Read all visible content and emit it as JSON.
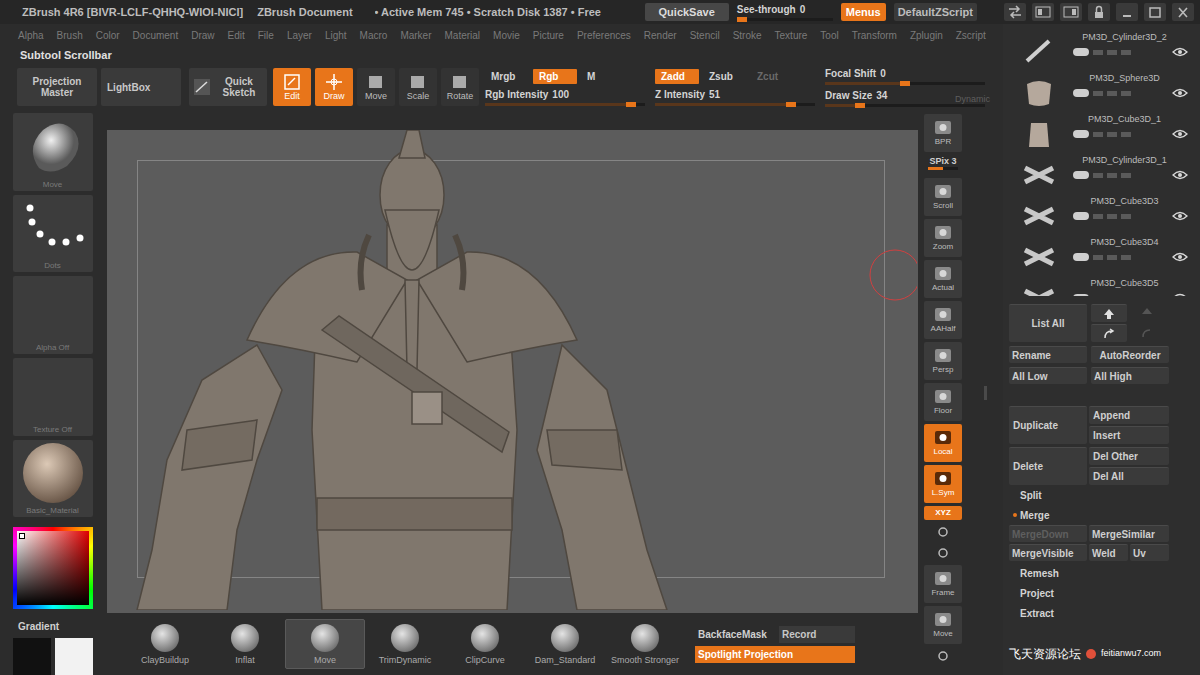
{
  "title_bar": {
    "app": "ZBrush 4R6 [BIVR-LCLF-QHHQ-WIOI-NICI]",
    "document": "ZBrush Document",
    "status": "• Active Mem 745 • Scratch Disk 1387 • Free",
    "quicksave": "QuickSave",
    "see_through": {
      "label": "See-through",
      "value": "0",
      "level": 0
    },
    "menus": {
      "label": "Menus",
      "on": true
    },
    "script": "DefaultZScript"
  },
  "menu_bar": [
    "Alpha",
    "Brush",
    "Color",
    "Document",
    "Draw",
    "Edit",
    "File",
    "Layer",
    "Light",
    "Macro",
    "Marker",
    "Material",
    "Movie",
    "Picture",
    "Preferences",
    "Render",
    "Stencil",
    "Stroke",
    "Texture",
    "Tool",
    "Transform",
    "Zplugin",
    "Zscript"
  ],
  "scrollbar_label": "Subtool Scrollbar",
  "toolbar": {
    "big_buttons": [
      "Projection Master",
      "LightBox",
      "Quick Sketch"
    ],
    "modes": [
      {
        "label": "Edit",
        "on": true
      },
      {
        "label": "Draw",
        "on": true
      },
      {
        "label": "Move",
        "on": false
      },
      {
        "label": "Scale",
        "on": false
      },
      {
        "label": "Rotate",
        "on": false
      }
    ],
    "color_modes": [
      {
        "label": "Mrgb",
        "on": false
      },
      {
        "label": "Rgb",
        "on": true
      },
      {
        "label": "M",
        "on": false
      }
    ],
    "rgb_intensity": {
      "label": "Rgb Intensity",
      "value": "100",
      "level": 0.94
    },
    "z_modes": [
      {
        "label": "Zadd",
        "on": true,
        "disabled": false
      },
      {
        "label": "Zsub",
        "on": false,
        "disabled": false
      },
      {
        "label": "Zcut",
        "on": false,
        "disabled": true
      }
    ],
    "z_intensity": {
      "label": "Z Intensity",
      "value": "51",
      "level": 0.87
    },
    "focal_shift": {
      "label": "Focal Shift",
      "value": "0",
      "level": 0.5
    },
    "draw_size": {
      "label": "Draw Size",
      "value": "34",
      "level": 0.2
    },
    "dynamic": {
      "label": "Dynamic",
      "disabled": true
    }
  },
  "left_tools": [
    {
      "label": "Move",
      "kind": "brush"
    },
    {
      "label": "Dots",
      "kind": "stroke"
    },
    {
      "label": "Alpha Off",
      "kind": "empty"
    },
    {
      "label": "Texture Off",
      "kind": "empty"
    },
    {
      "label": "Basic_Material",
      "kind": "material"
    }
  ],
  "gradient_label": "Gradient",
  "shelf": {
    "brushes": [
      {
        "label": "ClayBuildup",
        "selected": false
      },
      {
        "label": "Inflat",
        "selected": false
      },
      {
        "label": "Move",
        "selected": true
      },
      {
        "label": "TrimDynamic",
        "selected": false
      },
      {
        "label": "ClipCurve",
        "selected": false
      },
      {
        "label": "Dam_Standard",
        "selected": false
      },
      {
        "label": "Smooth Stronger",
        "selected": false
      }
    ],
    "backface_mask": {
      "label": "BackfaceMask",
      "on": false
    },
    "record": "Record",
    "spotlight": {
      "label": "Spotlight Projection",
      "on": true
    }
  },
  "view_strip": [
    {
      "label": "BPR",
      "kind": "icon",
      "on": false
    },
    {
      "label": "SPix 3",
      "kind": "slider",
      "level": 0.5
    },
    {
      "label": "Scroll",
      "kind": "icon",
      "on": false
    },
    {
      "label": "Zoom",
      "kind": "icon",
      "on": false
    },
    {
      "label": "Actual",
      "kind": "icon",
      "on": false
    },
    {
      "label": "AAHalf",
      "kind": "icon",
      "on": false
    },
    {
      "label": "Persp",
      "kind": "icon",
      "on": false
    },
    {
      "label": "Floor",
      "kind": "icon",
      "on": false
    },
    {
      "label": "Local",
      "kind": "icon",
      "on": true
    },
    {
      "label": "L.Sym",
      "kind": "icon",
      "on": true
    },
    {
      "label": "XYZ",
      "kind": "small",
      "on": true
    },
    {
      "kind": "mini",
      "on": false
    },
    {
      "kind": "mini",
      "on": false
    },
    {
      "label": "Frame",
      "kind": "icon",
      "on": false
    },
    {
      "label": "Move",
      "kind": "icon",
      "on": false
    },
    {
      "kind": "mini",
      "on": false
    }
  ],
  "subtools": {
    "items": [
      {
        "name": "PM3D_Cylinder3D_2",
        "visible": true,
        "selected": false
      },
      {
        "name": "PM3D_Sphere3D",
        "visible": true,
        "selected": false
      },
      {
        "name": "PM3D_Cube3D_1",
        "visible": true,
        "selected": false
      },
      {
        "name": "PM3D_Cylinder3D_1",
        "visible": true,
        "selected": false
      },
      {
        "name": "PM3D_Cube3D3",
        "visible": true,
        "selected": false
      },
      {
        "name": "PM3D_Cube3D4",
        "visible": true,
        "selected": false
      },
      {
        "name": "PM3D_Cube3D5",
        "visible": true,
        "selected": false
      }
    ],
    "buttons": {
      "list_all": "List All",
      "rename": "Rename",
      "auto_reorder": "AutoReorder",
      "all_low": "All Low",
      "all_high": "All High",
      "duplicate": "Duplicate",
      "append": "Append",
      "insert": "Insert",
      "delete": "Delete",
      "del_other": "Del Other",
      "del_all": "Del All"
    },
    "split": {
      "label": "Split",
      "expanded": false
    },
    "merge": {
      "label": "Merge",
      "expanded": true,
      "rows": [
        [
          {
            "label": "MergeDown",
            "disabled": true
          },
          {
            "label": "MergeSimilar",
            "disabled": false
          }
        ],
        [
          {
            "label": "MergeVisible",
            "disabled": false
          },
          {
            "label": "Weld",
            "disabled": false
          },
          {
            "label": "Uv",
            "disabled": false
          }
        ]
      ]
    },
    "after": [
      {
        "label": "Remesh",
        "expanded": false
      },
      {
        "label": "Project",
        "expanded": false
      },
      {
        "label": "Extract",
        "expanded": false
      }
    ]
  },
  "watermark": {
    "text": "飞天资源论坛",
    "site": "feitianwu7.com"
  }
}
